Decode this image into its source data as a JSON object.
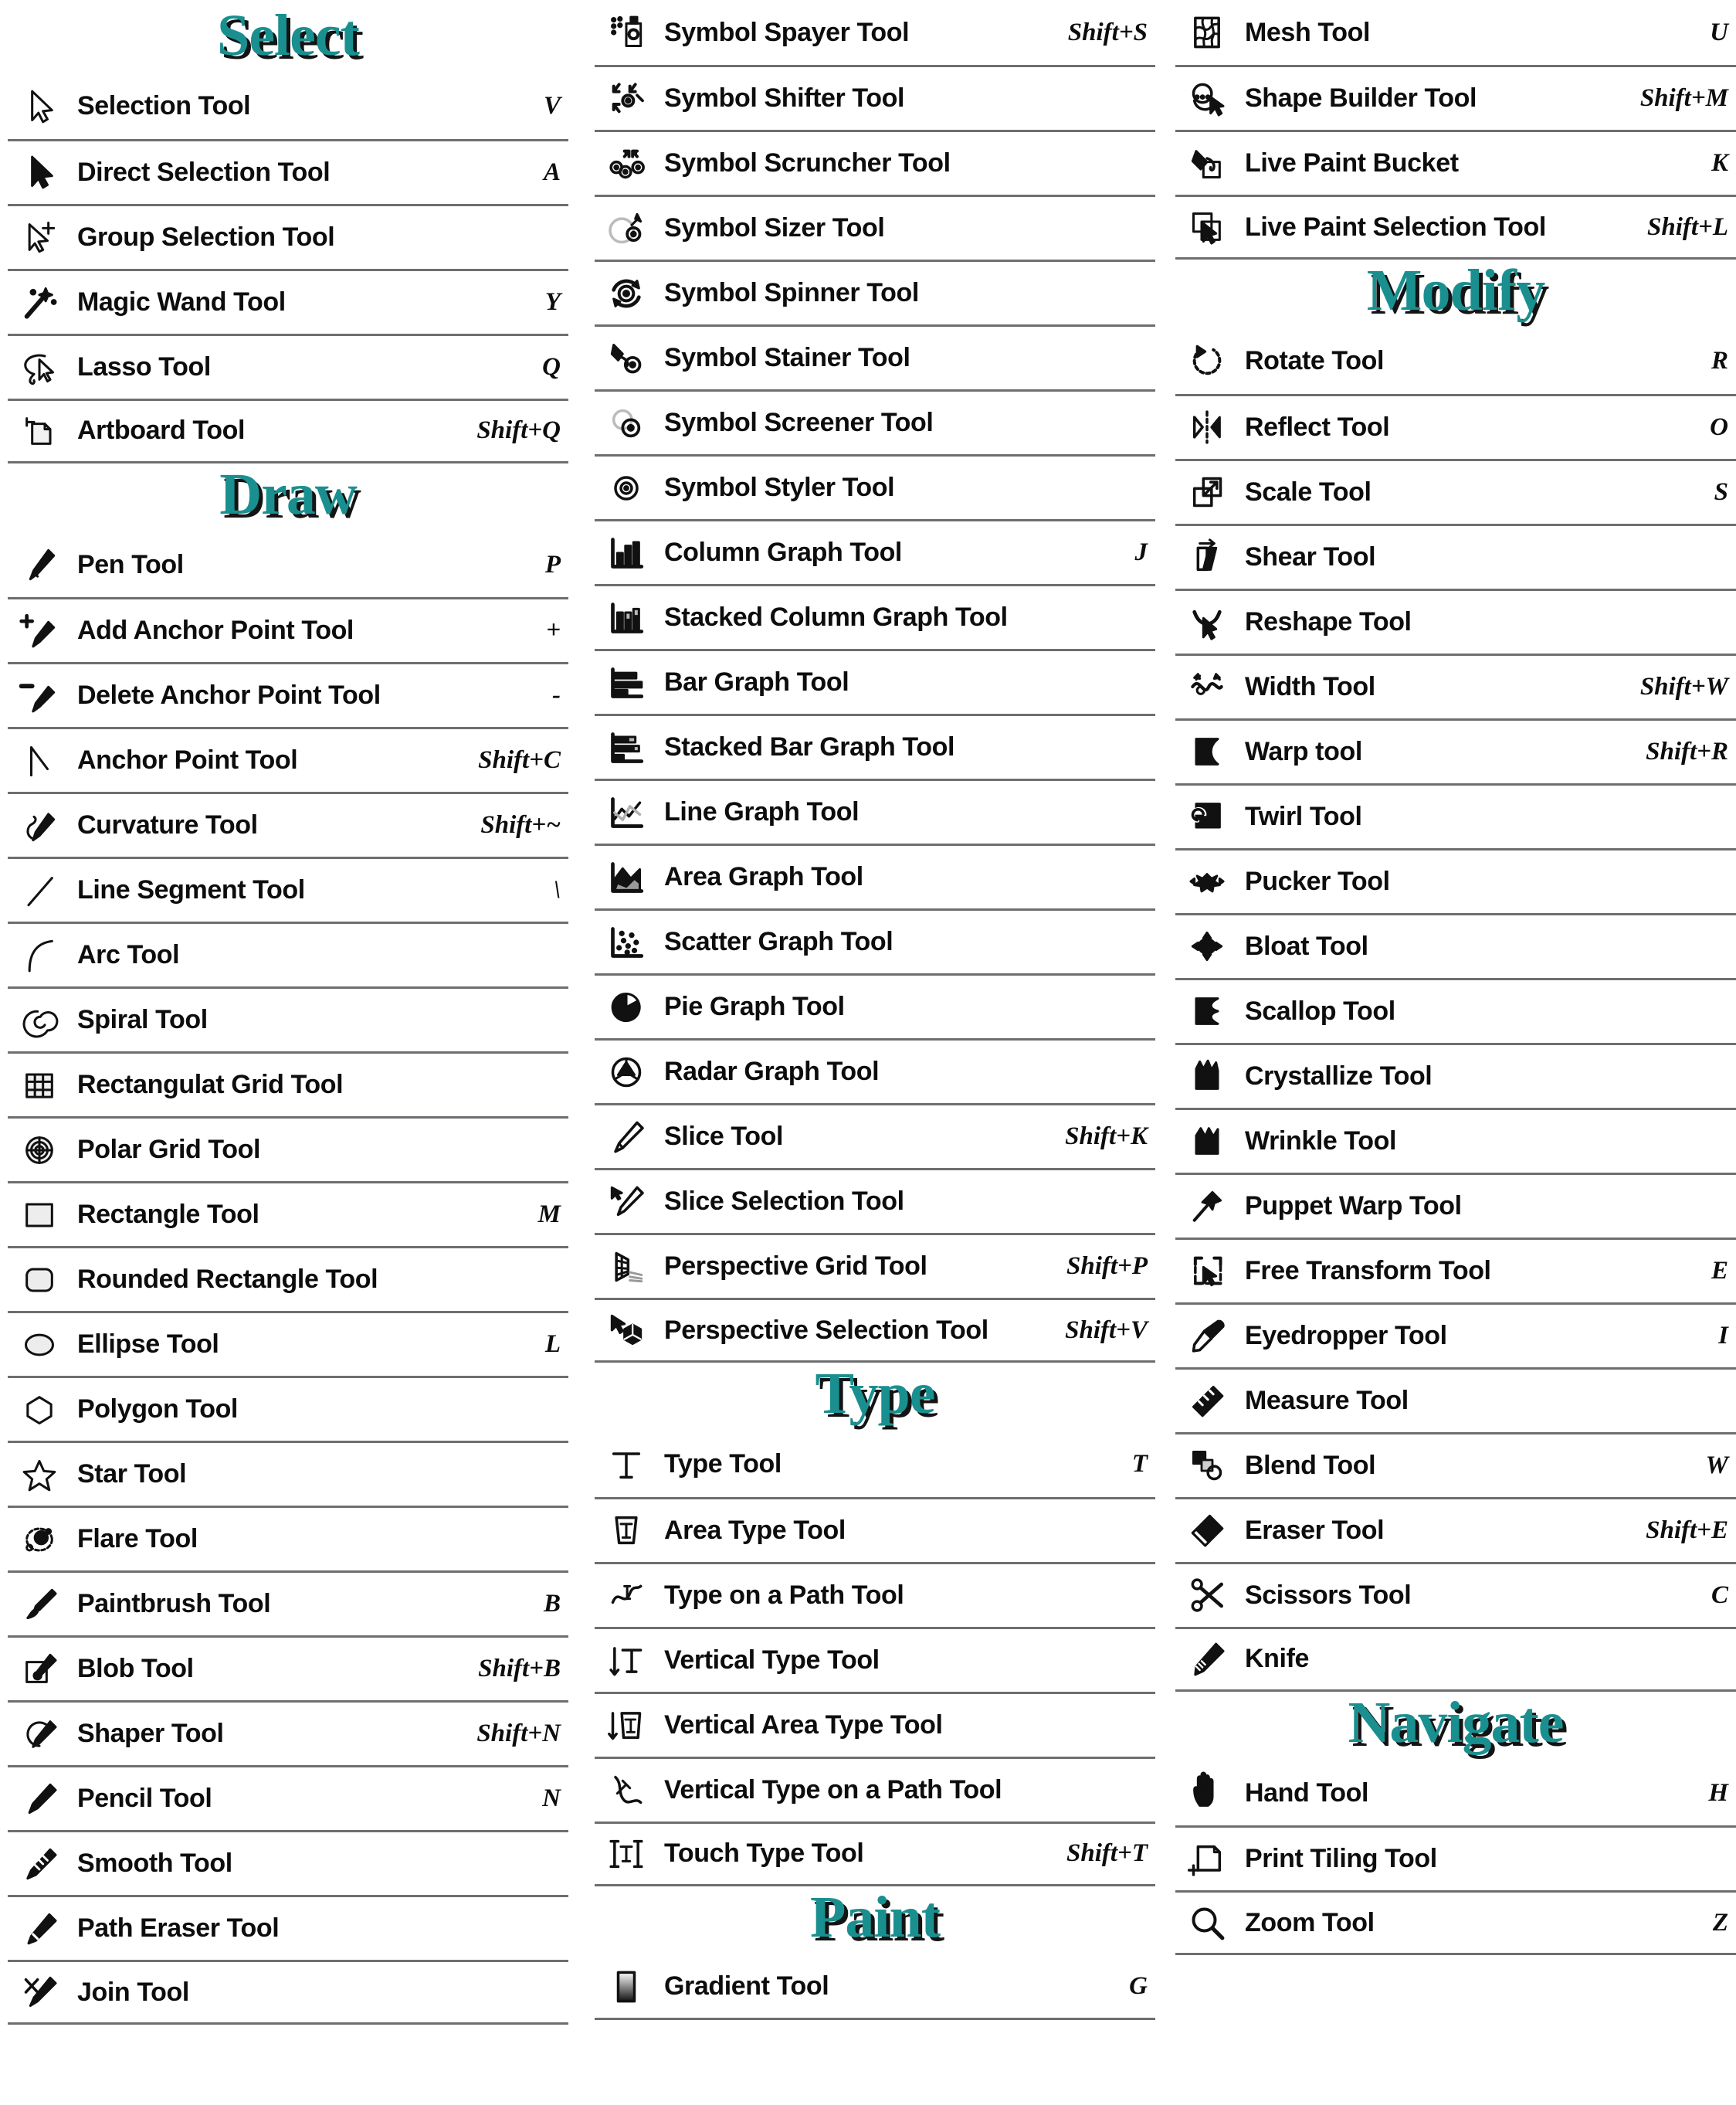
{
  "accent_color": "#1a8f8f",
  "rule_color": "#6e6e72",
  "text_color": "#0d0d0d",
  "columns": [
    {
      "id": "left",
      "blocks": [
        {
          "type": "section",
          "title": "Select",
          "tools": [
            {
              "icon": "selection-arrow-icon",
              "name": "Selection Tool",
              "key": "V"
            },
            {
              "icon": "direct-selection-arrow-icon",
              "name": "Direct Selection Tool",
              "key": "A"
            },
            {
              "icon": "group-selection-icon",
              "name": "Group Selection Tool",
              "key": ""
            },
            {
              "icon": "magic-wand-icon",
              "name": "Magic Wand Tool",
              "key": "Y"
            },
            {
              "icon": "lasso-icon",
              "name": "Lasso Tool",
              "key": "Q"
            },
            {
              "icon": "artboard-icon",
              "name": "Artboard Tool",
              "key": "Shift+Q"
            }
          ]
        },
        {
          "type": "section",
          "title": "Draw",
          "tools": [
            {
              "icon": "pen-icon",
              "name": "Pen Tool",
              "key": "P"
            },
            {
              "icon": "add-anchor-point-icon",
              "name": "Add Anchor Point Tool",
              "key": "+"
            },
            {
              "icon": "delete-anchor-point-icon",
              "name": "Delete Anchor Point Tool",
              "key": "-"
            },
            {
              "icon": "anchor-point-icon",
              "name": "Anchor Point Tool",
              "key": "Shift+C"
            },
            {
              "icon": "curvature-icon",
              "name": "Curvature Tool",
              "key": "Shift+~"
            },
            {
              "icon": "line-segment-icon",
              "name": "Line Segment Tool",
              "key": "\\"
            },
            {
              "icon": "arc-icon",
              "name": "Arc Tool",
              "key": ""
            },
            {
              "icon": "spiral-icon",
              "name": "Spiral Tool",
              "key": ""
            },
            {
              "icon": "rectangular-grid-icon",
              "name": "Rectangulat Grid Tool",
              "key": ""
            },
            {
              "icon": "polar-grid-icon",
              "name": "Polar Grid Tool",
              "key": ""
            },
            {
              "icon": "rectangle-icon",
              "name": "Rectangle Tool",
              "key": "M"
            },
            {
              "icon": "rounded-rectangle-icon",
              "name": "Rounded Rectangle Tool",
              "key": ""
            },
            {
              "icon": "ellipse-icon",
              "name": "Ellipse Tool",
              "key": "L"
            },
            {
              "icon": "polygon-icon",
              "name": "Polygon Tool",
              "key": ""
            },
            {
              "icon": "star-icon",
              "name": "Star Tool",
              "key": ""
            },
            {
              "icon": "flare-icon",
              "name": "Flare Tool",
              "key": ""
            },
            {
              "icon": "paintbrush-icon",
              "name": "Paintbrush Tool",
              "key": "B"
            },
            {
              "icon": "blob-brush-icon",
              "name": "Blob Tool",
              "key": "Shift+B"
            },
            {
              "icon": "shaper-icon",
              "name": "Shaper Tool",
              "key": "Shift+N"
            },
            {
              "icon": "pencil-icon",
              "name": "Pencil Tool",
              "key": "N"
            },
            {
              "icon": "smooth-icon",
              "name": "Smooth Tool",
              "key": ""
            },
            {
              "icon": "path-eraser-icon",
              "name": "Path Eraser Tool",
              "key": ""
            },
            {
              "icon": "join-icon",
              "name": "Join Tool",
              "key": ""
            }
          ]
        }
      ]
    },
    {
      "id": "middle",
      "blocks": [
        {
          "type": "plain",
          "tools": [
            {
              "icon": "symbol-sprayer-icon",
              "name": "Symbol Spayer Tool",
              "key": "Shift+S"
            },
            {
              "icon": "symbol-shifter-icon",
              "name": "Symbol Shifter Tool",
              "key": ""
            },
            {
              "icon": "symbol-scruncher-icon",
              "name": "Symbol Scruncher Tool",
              "key": ""
            },
            {
              "icon": "symbol-sizer-icon",
              "name": "Symbol Sizer Tool",
              "key": ""
            },
            {
              "icon": "symbol-spinner-icon",
              "name": "Symbol Spinner Tool",
              "key": ""
            },
            {
              "icon": "symbol-stainer-icon",
              "name": "Symbol Stainer Tool",
              "key": ""
            },
            {
              "icon": "symbol-screener-icon",
              "name": "Symbol Screener Tool",
              "key": ""
            },
            {
              "icon": "symbol-styler-icon",
              "name": "Symbol Styler Tool",
              "key": ""
            },
            {
              "icon": "column-graph-icon",
              "name": "Column Graph Tool",
              "key": "J"
            },
            {
              "icon": "stacked-column-graph-icon",
              "name": "Stacked Column Graph Tool",
              "key": ""
            },
            {
              "icon": "bar-graph-icon",
              "name": "Bar Graph Tool",
              "key": ""
            },
            {
              "icon": "stacked-bar-graph-icon",
              "name": "Stacked Bar Graph Tool",
              "key": ""
            },
            {
              "icon": "line-graph-icon",
              "name": "Line Graph Tool",
              "key": ""
            },
            {
              "icon": "area-graph-icon",
              "name": "Area Graph Tool",
              "key": ""
            },
            {
              "icon": "scatter-graph-icon",
              "name": "Scatter Graph Tool",
              "key": ""
            },
            {
              "icon": "pie-graph-icon",
              "name": "Pie Graph Tool",
              "key": ""
            },
            {
              "icon": "radar-graph-icon",
              "name": "Radar Graph Tool",
              "key": ""
            },
            {
              "icon": "slice-icon",
              "name": "Slice Tool",
              "key": "Shift+K"
            },
            {
              "icon": "slice-selection-icon",
              "name": "Slice Selection Tool",
              "key": ""
            },
            {
              "icon": "perspective-grid-icon",
              "name": "Perspective Grid Tool",
              "key": "Shift+P"
            },
            {
              "icon": "perspective-selection-icon",
              "name": "Perspective Selection Tool",
              "key": "Shift+V"
            }
          ]
        },
        {
          "type": "section",
          "title": "Type",
          "tools": [
            {
              "icon": "type-icon",
              "name": "Type Tool",
              "key": "T"
            },
            {
              "icon": "area-type-icon",
              "name": "Area Type Tool",
              "key": ""
            },
            {
              "icon": "type-on-path-icon",
              "name": "Type on a Path Tool",
              "key": ""
            },
            {
              "icon": "vertical-type-icon",
              "name": "Vertical Type Tool",
              "key": ""
            },
            {
              "icon": "vertical-area-type-icon",
              "name": "Vertical Area Type Tool",
              "key": ""
            },
            {
              "icon": "vertical-type-on-path-icon",
              "name": "Vertical Type on a Path Tool",
              "key": ""
            },
            {
              "icon": "touch-type-icon",
              "name": "Touch Type Tool",
              "key": "Shift+T"
            }
          ]
        },
        {
          "type": "section",
          "title": "Paint",
          "tools": [
            {
              "icon": "gradient-icon",
              "name": "Gradient Tool",
              "key": "G"
            }
          ]
        }
      ]
    },
    {
      "id": "right",
      "blocks": [
        {
          "type": "plain",
          "tools": [
            {
              "icon": "mesh-icon",
              "name": "Mesh Tool",
              "key": "U"
            },
            {
              "icon": "shape-builder-icon",
              "name": "Shape Builder Tool",
              "key": "Shift+M"
            },
            {
              "icon": "live-paint-bucket-icon",
              "name": "Live Paint Bucket",
              "key": "K"
            },
            {
              "icon": "live-paint-selection-icon",
              "name": "Live Paint Selection Tool",
              "key": "Shift+L"
            }
          ]
        },
        {
          "type": "section",
          "title": "Modify",
          "tools": [
            {
              "icon": "rotate-icon",
              "name": "Rotate Tool",
              "key": "R"
            },
            {
              "icon": "reflect-icon",
              "name": "Reflect Tool",
              "key": "O"
            },
            {
              "icon": "scale-icon",
              "name": "Scale Tool",
              "key": "S"
            },
            {
              "icon": "shear-icon",
              "name": "Shear Tool",
              "key": ""
            },
            {
              "icon": "reshape-icon",
              "name": "Reshape Tool",
              "key": ""
            },
            {
              "icon": "width-icon",
              "name": "Width Tool",
              "key": "Shift+W"
            },
            {
              "icon": "warp-icon",
              "name": "Warp tool",
              "key": "Shift+R"
            },
            {
              "icon": "twirl-icon",
              "name": "Twirl Tool",
              "key": ""
            },
            {
              "icon": "pucker-icon",
              "name": "Pucker Tool",
              "key": ""
            },
            {
              "icon": "bloat-icon",
              "name": "Bloat Tool",
              "key": ""
            },
            {
              "icon": "scallop-icon",
              "name": "Scallop Tool",
              "key": ""
            },
            {
              "icon": "crystallize-icon",
              "name": "Crystallize Tool",
              "key": ""
            },
            {
              "icon": "wrinkle-icon",
              "name": "Wrinkle Tool",
              "key": ""
            },
            {
              "icon": "puppet-warp-icon",
              "name": "Puppet Warp Tool",
              "key": ""
            },
            {
              "icon": "free-transform-icon",
              "name": "Free Transform Tool",
              "key": "E"
            },
            {
              "icon": "eyedropper-icon",
              "name": "Eyedropper Tool",
              "key": "I"
            },
            {
              "icon": "measure-icon",
              "name": "Measure Tool",
              "key": ""
            },
            {
              "icon": "blend-icon",
              "name": "Blend Tool",
              "key": "W"
            },
            {
              "icon": "eraser-icon",
              "name": "Eraser Tool",
              "key": "Shift+E"
            },
            {
              "icon": "scissors-icon",
              "name": "Scissors Tool",
              "key": "C"
            },
            {
              "icon": "knife-icon",
              "name": "Knife",
              "key": ""
            }
          ]
        },
        {
          "type": "section",
          "title": "Navigate",
          "tools": [
            {
              "icon": "hand-icon",
              "name": "Hand Tool",
              "key": "H"
            },
            {
              "icon": "print-tiling-icon",
              "name": "Print Tiling Tool",
              "key": ""
            },
            {
              "icon": "zoom-icon",
              "name": "Zoom Tool",
              "key": "Z"
            }
          ]
        }
      ]
    }
  ]
}
